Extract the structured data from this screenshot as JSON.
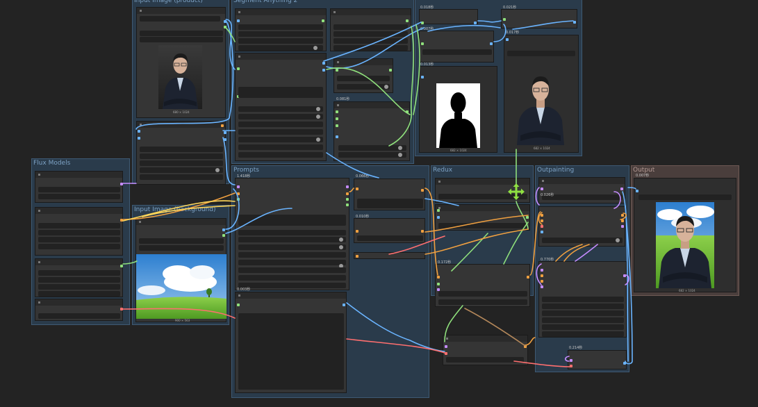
{
  "groups": {
    "input_person": "Input Image (product)",
    "segment_anything": "Segment Anything 2",
    "flux_models": "Flux Models",
    "input_background": "Input Image (background)",
    "prompts": "Prompts",
    "redux": "Redux",
    "outpainting": "Outpainting",
    "output": "Output"
  },
  "timings": {
    "t_seg_a": "0.018秒",
    "t_seg_b": "0.021秒",
    "t_seg_c": "0.007秒",
    "t_seg_d": "0.013秒",
    "t_seg_e": "0.017秒",
    "t_seg_f": "0.081秒",
    "t_prompt_a": "1.418秒",
    "t_prompt_b": "0.066秒",
    "t_prompt_c": "0.010秒",
    "t_prompt_d": "0.003秒",
    "t_redux": "0.172秒",
    "t_out_a": "0.026秒",
    "t_out_b": "0.770秒",
    "t_out_c": "0.214秒",
    "t_output": "0.007秒"
  },
  "image_captions": {
    "person": "680 × 1024",
    "mask": "682 × 1024",
    "cutout": "682 × 1024",
    "background": "900 × 563",
    "result": "682 × 1024"
  },
  "colors": {
    "model_wire": "#c58cff",
    "image_wire": "#6ab4ff",
    "mask_wire": "#8fe07c",
    "vae_wire": "#ff6f6f",
    "conditioning_wire": "#f0a040",
    "clip_wire": "#ffd75a",
    "accent_move": "#8fe041"
  },
  "icons": {
    "move_cursor": "move-cursor-icon"
  }
}
